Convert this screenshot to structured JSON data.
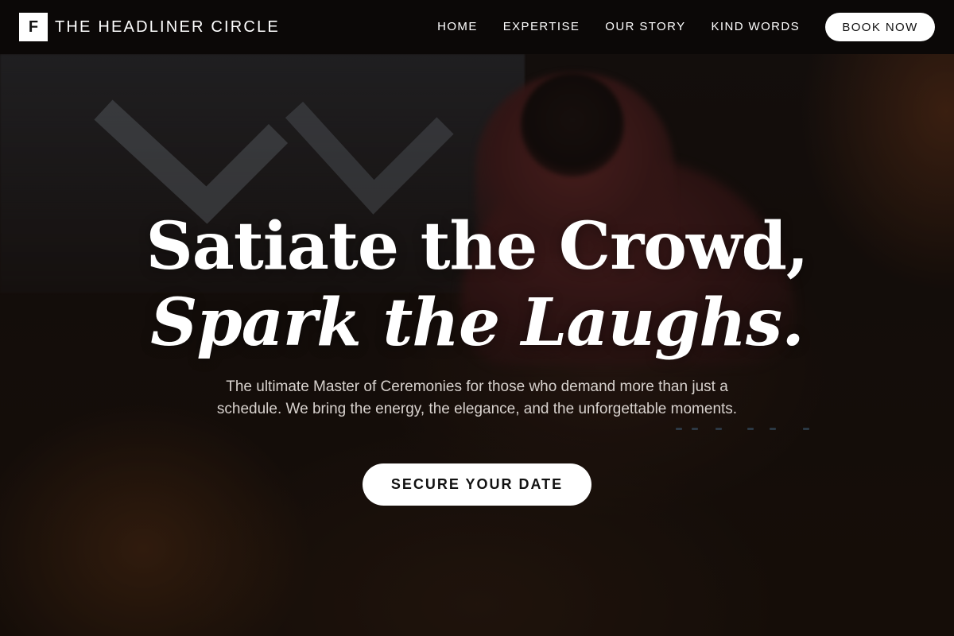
{
  "brand": {
    "logo_letter": "F",
    "name": "THE HEADLINER CIRCLE"
  },
  "nav": {
    "links": [
      "HOME",
      "EXPERTISE",
      "OUR STORY",
      "KIND WORDS"
    ],
    "cta_label": "BOOK NOW"
  },
  "hero": {
    "headline_line1": "Satiate the Crowd,",
    "headline_line2": "Spark the Laughs.",
    "subtitle": "The ultimate Master of Ceremonies for those who demand more than just a schedule. We bring the energy, the elegance, and the unforgettable moments.",
    "cta_label": "SECURE YOUR DATE"
  },
  "colors": {
    "navbar_bg": "#0b0807",
    "button_bg": "#ffffff",
    "button_text": "#111111",
    "text_primary": "#ffffff",
    "text_secondary": "#d8d2ce"
  }
}
